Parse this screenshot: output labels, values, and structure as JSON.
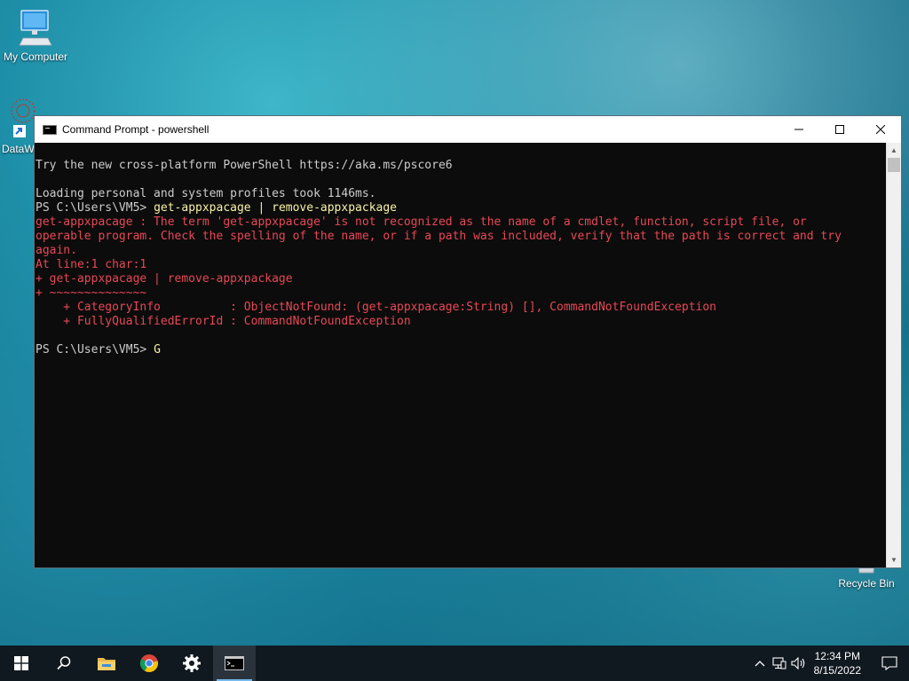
{
  "desktop": {
    "icons": [
      {
        "label": "My Computer",
        "icon": "monitor-icon"
      },
      {
        "label": "DataW",
        "icon": "datawrapper-icon"
      },
      {
        "label": "Recycle Bin",
        "icon": "recycle-bin-icon"
      }
    ]
  },
  "window": {
    "title": "Command Prompt - powershell",
    "controls": {
      "minimize": "—",
      "maximize": "☐",
      "close": "✕"
    }
  },
  "console": {
    "lines": [
      {
        "text": "Try the new cross-platform PowerShell https://aka.ms/pscore6",
        "color": "#cccccc"
      },
      {
        "text": "",
        "color": "#cccccc"
      },
      {
        "text": "Loading personal and system profiles took 1146ms.",
        "color": "#cccccc"
      },
      {
        "prompt": "PS C:\\Users\\VM5> ",
        "command": "get-appxpacage | remove-appxpackage"
      },
      {
        "text": "get-appxpacage : The term 'get-appxpacage' is not recognized as the name of a cmdlet, function, script file, or",
        "color": "#e74856"
      },
      {
        "text": "operable program. Check the spelling of the name, or if a path was included, verify that the path is correct and try",
        "color": "#e74856"
      },
      {
        "text": "again.",
        "color": "#e74856"
      },
      {
        "text": "At line:1 char:1",
        "color": "#e74856"
      },
      {
        "text": "+ get-appxpacage | remove-appxpackage",
        "color": "#e74856"
      },
      {
        "text": "+ ~~~~~~~~~~~~~~",
        "color": "#e74856"
      },
      {
        "text": "    + CategoryInfo          : ObjectNotFound: (get-appxpacage:String) [], CommandNotFoundException",
        "color": "#e74856"
      },
      {
        "text": "    + FullyQualifiedErrorId : CommandNotFoundException",
        "color": "#e74856"
      },
      {
        "text": "",
        "color": "#cccccc"
      },
      {
        "prompt": "PS C:\\Users\\VM5> ",
        "command": "G"
      }
    ]
  },
  "taskbar": {
    "items": [
      {
        "name": "start-button",
        "icon": "windows-logo-icon"
      },
      {
        "name": "search-button",
        "icon": "search-icon"
      },
      {
        "name": "file-explorer-button",
        "icon": "folder-icon"
      },
      {
        "name": "chrome-button",
        "icon": "chrome-icon"
      },
      {
        "name": "settings-button",
        "icon": "gear-icon"
      },
      {
        "name": "command-prompt-button",
        "icon": "terminal-icon"
      }
    ],
    "tray": {
      "chevron": "^",
      "time": "12:34 PM",
      "date": "8/15/2022"
    }
  },
  "colors": {
    "console_bg": "#0c0c0c",
    "console_text": "#cccccc",
    "error_text": "#e74856",
    "command_text": "#f9f1a5",
    "taskbar_bg": "#101820",
    "accent": "#76b9ed"
  }
}
